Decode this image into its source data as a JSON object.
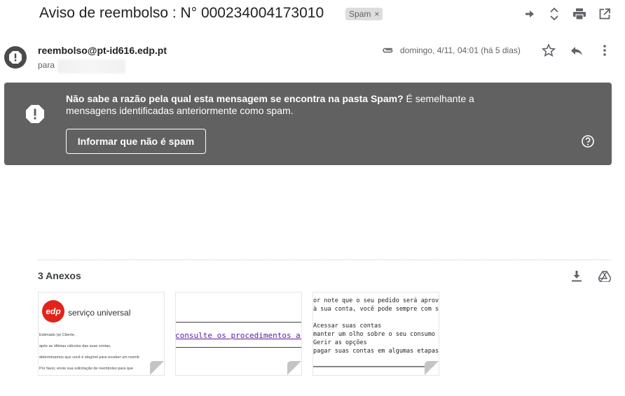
{
  "email": {
    "subject": "Aviso de reembolso : N° 000234004173010",
    "label_chip": "Spam",
    "label_remove": "×",
    "sender": "reembolso@pt-id616.edp.pt",
    "to_label": "para",
    "date": "domingo, 4/11, 04:01 (há 5 dias)"
  },
  "toolbar_icons": [
    "forward-arrow-icon",
    "expand-collapse-icon",
    "print-icon",
    "open-new-window-icon"
  ],
  "header_icons": [
    "star-icon",
    "reply-icon",
    "more-vert-icon"
  ],
  "spam_banner": {
    "bold_text": "Não sabe a razão pela qual esta mensagem se encontra na pasta Spam?",
    "rest_text": " É semelhante a mensagens identificadas anteriormente como spam.",
    "button_label": "Informar que não é spam",
    "background": "#616161"
  },
  "attachments": {
    "title": "3 Anexos",
    "thumb1": {
      "logo": "edp",
      "brand": "serviço universal",
      "lines": [
        "Estimado (a) Cliente,",
        "após as últimas cálculos das suas contas,",
        "determinamos que você é elegível para receber um reemb",
        "Por favor, envie sua solicitação de reembolso para que"
      ]
    },
    "thumb2": {
      "link": "consulte os procedimentos a seg"
    },
    "thumb3": {
      "lines": [
        "or note que o seu pedido será aprovado",
        "à sua conta, você pode sempre com seg",
        "",
        "Acessar suas contas",
        "manter um olho sobre o seu consumo",
        "Gerir as opções",
        "pagar suas contas em algumas etapas"
      ]
    }
  }
}
